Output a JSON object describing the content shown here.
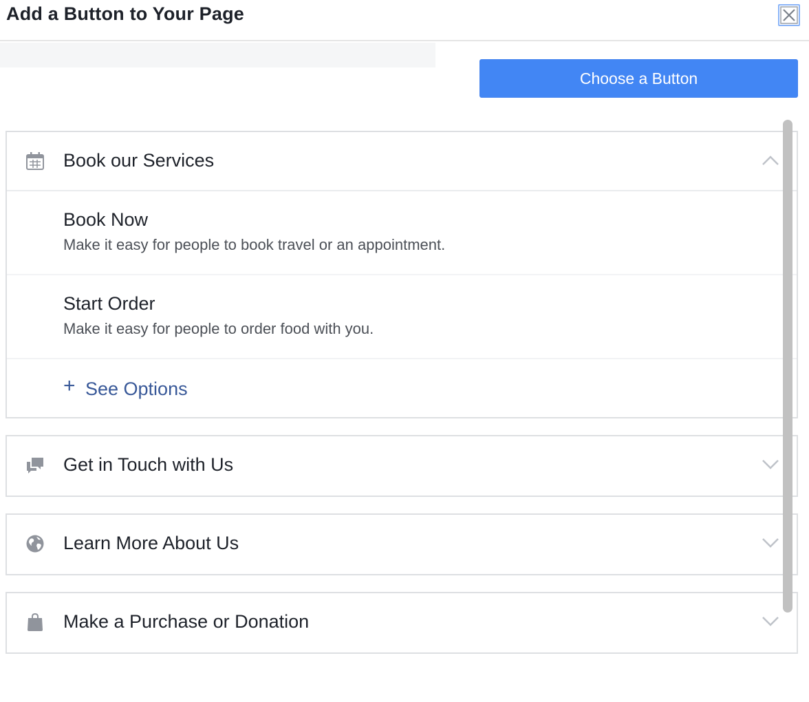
{
  "dialog": {
    "title": "Add a Button to Your Page",
    "close_icon": "close-icon"
  },
  "primary_button": {
    "label": "Choose a Button",
    "color": "#4286f4"
  },
  "sections": [
    {
      "label": "Book our Services",
      "icon": "calendar-icon",
      "expanded": true,
      "options": [
        {
          "title": "Book Now",
          "description": "Make it easy for people to book travel or an appointment."
        },
        {
          "title": "Start Order",
          "description": "Make it easy for people to order food with you."
        }
      ],
      "see_options_plus": "+",
      "see_options_label": "See Options"
    },
    {
      "label": "Get in Touch with Us",
      "icon": "chat-bubbles-icon",
      "expanded": false
    },
    {
      "label": "Learn More About Us",
      "icon": "globe-icon",
      "expanded": false
    },
    {
      "label": "Make a Purchase or Donation",
      "icon": "shopping-bag-icon",
      "expanded": false
    }
  ],
  "colors": {
    "link": "#385898",
    "icon": "#90949c",
    "border": "#dddfe2"
  }
}
